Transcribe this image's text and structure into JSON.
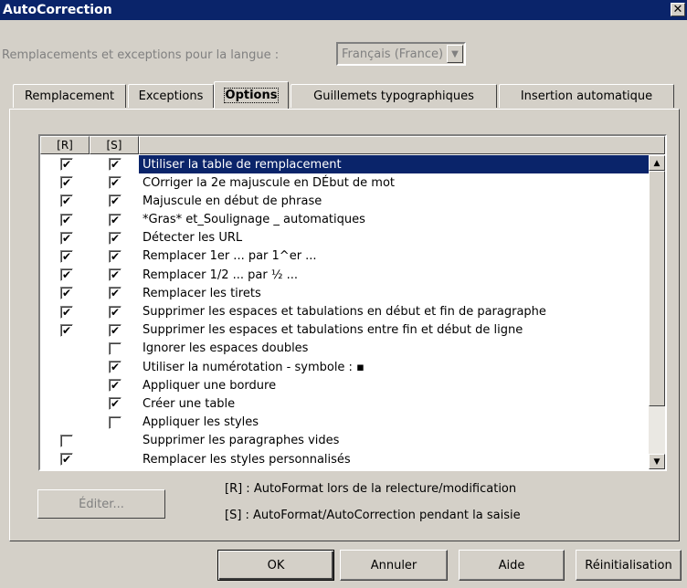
{
  "window": {
    "title": "AutoCorrection",
    "close_glyph": "✕"
  },
  "language": {
    "label": "Remplacements et exceptions pour la langue :",
    "value": "Français (France)"
  },
  "tabs": [
    {
      "label": "Remplacement"
    },
    {
      "label": "Exceptions"
    },
    {
      "label": "Options"
    },
    {
      "label": "Guillemets typographiques"
    },
    {
      "label": "Insertion automatique"
    }
  ],
  "active_tab": "Options",
  "list": {
    "headers": {
      "r": "[R]",
      "s": "[S]",
      "text": ""
    },
    "selected_index": 0,
    "rows": [
      {
        "r": true,
        "s": true,
        "text": "Utiliser la table de remplacement"
      },
      {
        "r": true,
        "s": true,
        "text": "COrriger la 2e majuscule en DÉbut de mot"
      },
      {
        "r": true,
        "s": true,
        "text": "Majuscule en début de phrase"
      },
      {
        "r": true,
        "s": true,
        "text": "*Gras* et_Soulignage _ automatiques"
      },
      {
        "r": true,
        "s": true,
        "text": "Détecter les URL"
      },
      {
        "r": true,
        "s": true,
        "text": "Remplacer 1er ... par 1^er ..."
      },
      {
        "r": true,
        "s": true,
        "text": "Remplacer 1/2 ... par ½ ..."
      },
      {
        "r": true,
        "s": true,
        "text": "Remplacer les tirets"
      },
      {
        "r": true,
        "s": true,
        "text": "Supprimer les espaces et tabulations en début et fin de paragraphe"
      },
      {
        "r": true,
        "s": true,
        "text": "Supprimer les espaces et tabulations entre fin et début de ligne"
      },
      {
        "r": null,
        "s": false,
        "text": "Ignorer les espaces doubles"
      },
      {
        "r": null,
        "s": true,
        "text": "Utiliser la numérotation - symbole : ▪"
      },
      {
        "r": null,
        "s": true,
        "text": "Appliquer une bordure"
      },
      {
        "r": null,
        "s": true,
        "text": "Créer une table"
      },
      {
        "r": null,
        "s": false,
        "text": "Appliquer les styles"
      },
      {
        "r": false,
        "s": null,
        "text": "Supprimer les paragraphes vides"
      },
      {
        "r": true,
        "s": null,
        "text": "Remplacer les styles personnalisés"
      }
    ]
  },
  "edit_button": {
    "label": "Éditer..."
  },
  "legend": {
    "r": "[R] : AutoFormat lors de la relecture/modification",
    "s": "[S] : AutoFormat/AutoCorrection pendant la saisie"
  },
  "buttons": {
    "ok": "OK",
    "cancel": "Annuler",
    "help": "Aide",
    "reset": "Réinitialisation"
  },
  "colors": {
    "titlebar": "#0a246a",
    "face": "#d4d0c8",
    "selection": "#0a246a"
  }
}
